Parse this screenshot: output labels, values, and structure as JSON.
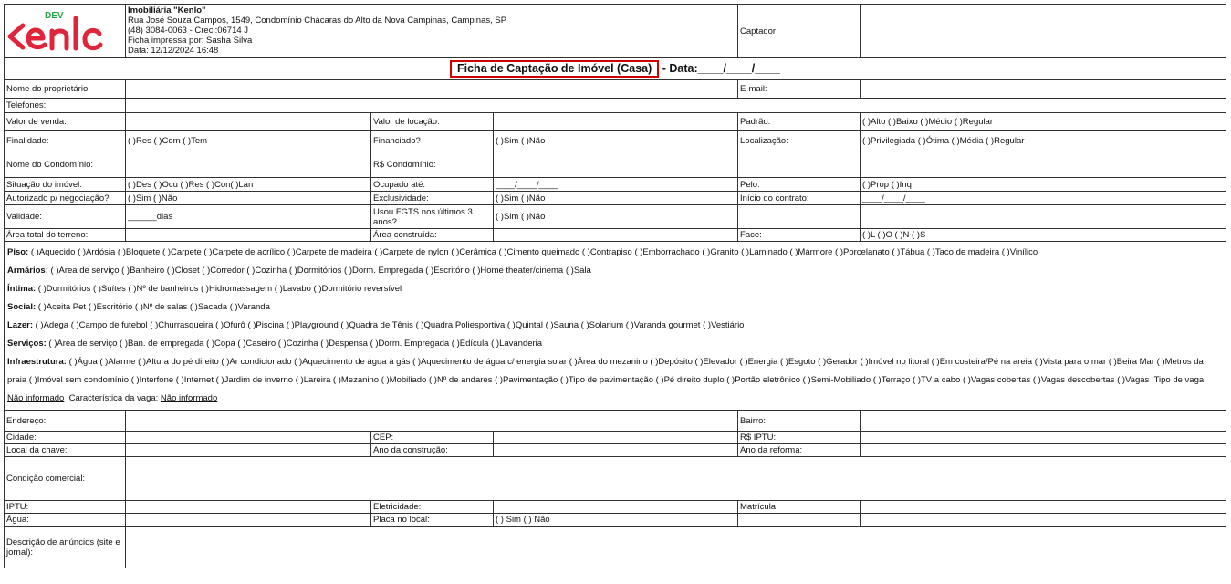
{
  "header": {
    "logo_dev": "DEV",
    "logo_alt": "Kenlo",
    "company_name": "Imobiliária \"Kenlo\"",
    "address": "Rua José Souza Campos, 1549, Condomínio Chácaras do Alto da Nova Campinas, Campinas, SP",
    "phone_creci": "(48) 3084-0063 - Creci:06714 J",
    "printed_by": "Ficha impressa por: Sasha Silva",
    "date": "Data: 12/12/2024 16:48",
    "captador_label": "Captador:"
  },
  "title": {
    "main": "Ficha de Captação de Imóvel (Casa)",
    "date_suffix": " - Data:____/____/____"
  },
  "fields": {
    "owner": "Nome do proprietário:",
    "email": "E-mail:",
    "phones": "Telefones:",
    "sale_value": "Valor de venda:",
    "rent_value": "Valor de locação:",
    "standard": "Padrão:",
    "standard_opts": "(  )Alto (  )Baixo (  )Médio (  )Regular",
    "purpose": "Finalidade:",
    "purpose_opts": "(   )Res (   )Com (   )Tem",
    "financed": "Financiado?",
    "financed_opts": "(   )Sim (   )Não",
    "location": "Localização:",
    "location_opts": "(   )Privilegiada  (   )Ótima  (   )Média  (   )Regular",
    "condo_name": "Nome do Condomínio:",
    "condo_fee": "R$ Condomínio:",
    "situation": "Situação do imóvel:",
    "situation_opts": "(   )Des (   )Ocu (   )Res (   )Con(   )Lan",
    "occupied_until": "Ocupado até:",
    "occupied_until_value": "____/____/____",
    "by": "Pelo:",
    "by_opts": "(   )Prop (   )Inq",
    "authorized": "Autorizado p/ negociação?",
    "authorized_opts": "(   )Sim (   )Não",
    "exclusivity": "Exclusividade:",
    "exclusivity_opts": "(   )Sim (   )Não",
    "contract_start": "Início do contrato:",
    "contract_start_value": "____/____/____",
    "validity": "Validade:",
    "validity_value": "______dias",
    "fgts": "Usou FGTS nos últimos 3 anos?",
    "fgts_opts": "(   )Sim (   )Não",
    "land_area": "Área total do terreno:",
    "built_area": "Área construída:",
    "face": "Face:",
    "face_opts": "(   )L (   )O (   )N (   )S",
    "address_label": "Endereço:",
    "district": "Bairro:",
    "city": "Cidade:",
    "cep": "CEP:",
    "iptu_value": "R$ IPTU:",
    "key_location": "Local da chave:",
    "construction_year": "Ano da construção:",
    "renovation_year": "Ano da reforma:",
    "commercial_condition": "Condição comercial:",
    "iptu": "IPTU:",
    "electricity": "Eletricidade:",
    "registration": "Matrícula:",
    "water": "Água:",
    "sign_on_site": "Placa no local:",
    "sign_on_site_opts": "(   ) Sim (   ) Não",
    "ad_description": "Descrição de anúncios (site e jornal):"
  },
  "lists": {
    "piso_label": "Piso:",
    "piso": "(  )Aquecido  (  )Ardósia  (  )Bloquete  (  )Carpete  (  )Carpete de acrílico  (  )Carpete de madeira  (  )Carpete de nylon  (  )Cerâmica  (  )Cimento queimado  (  )Contrapiso  (  )Emborrachado  (  )Granito  (  )Laminado  (  )Mármore  (  )Porcelanato  (  )Tábua  (  )Taco de madeira  (  )Vinílico",
    "armarios_label": "Armários:",
    "armarios": "(  )Área de serviço  (  )Banheiro  (  )Closet  (  )Corredor  (  )Cozinha  (  )Dormitórios  (  )Dorm. Empregada  (  )Escritório  (  )Home theater/cinema  (  )Sala",
    "intima_label": "Íntima:",
    "intima": "(  )Dormitórios  (  )Suítes  (  )Nº de banheiros  (  )Hidromassagem  (  )Lavabo  (  )Dormitório reversível",
    "social_label": "Social:",
    "social": "(  )Aceita Pet  (  )Escritório  (  )Nº de salas  (  )Sacada  (  )Varanda",
    "lazer_label": "Lazer:",
    "lazer": "(  )Adega  (  )Campo de futebol  (  )Churrasqueira  (  )Ofurô  (  )Piscina  (  )Playground  (  )Quadra de Tênis  (  )Quadra Poliesportiva  (  )Quintal  (  )Sauna  (  )Solarium  (  )Varanda gourmet  (  )Vestiário",
    "servicos_label": "Serviços:",
    "servicos": "(  )Área de serviço  (  )Ban. de empregada  (  )Copa  (  )Caseiro  (  )Cozinha  (  )Despensa  (  )Dorm. Empregada  (  )Edícula  (  )Lavanderia",
    "infra_label": "Infraestrutura:",
    "infra": "(  )Água  (  )Alarme  (  )Altura do pé direito  (  )Ar condicionado  (  )Aquecimento de água à gás  (  )Aquecimento de água c/ energia solar  (  )Área do mezanino  (  )Depósito  (  )Elevador  (  )Energia  (  )Esgoto  (  )Gerador  (  )Imóvel no litoral  (  )Em costeira/Pé na areia  (  )Vista para o mar  (  )Beira Mar  (  )Metros da praia  (  )Imóvel sem condomínio  (  )Interfone  (  )Internet  (  )Jardim de inverno  (  )Lareira  (  )Mezanino  (  )Mobiliado  (  )Nº de andares  (  )Pavimentação  (  )Tipo de pavimentação  (  )Pé direito duplo  (  )Portão eletrônico  (  )Semi-Mobiliado  (  )Terraço  (  )TV a cabo  (  )Vagas cobertas  (  )Vagas descobertas  (  )Vagas",
    "tipo_vaga_label": "Tipo de vaga:",
    "tipo_vaga_value": "Não informado",
    "caract_vaga_label": "Característica da vaga:",
    "caract_vaga_value": "Não informado"
  }
}
